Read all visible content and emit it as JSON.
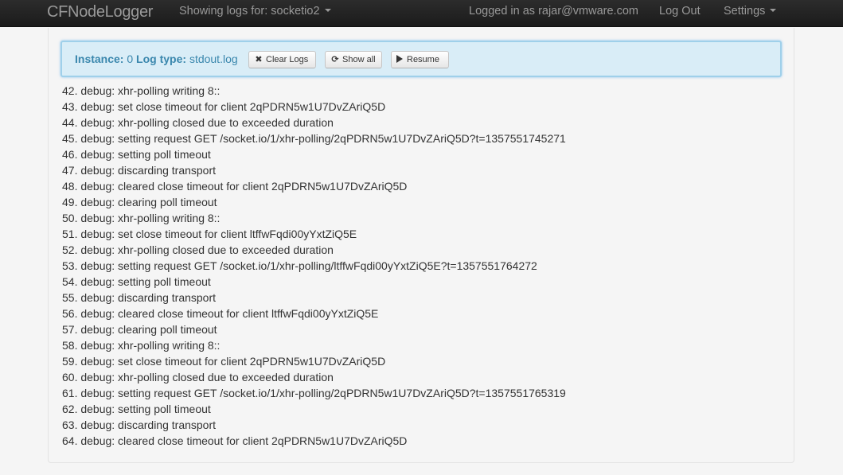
{
  "navbar": {
    "brand": "CFNodeLogger",
    "showing": "Showing logs for: socketio2",
    "logged_in": "Logged in as rajar@vmware.com",
    "logout": "Log Out",
    "settings": "Settings"
  },
  "toolbar": {
    "instance_label": "Instance:",
    "instance_value": "0",
    "logtype_label": "Log type:",
    "logtype_value": "stdout.log",
    "clear_label": "Clear Logs",
    "showall_label": "Show all",
    "resume_label": "Resume"
  },
  "logs": [
    "42. debug: xhr-polling writing 8::",
    "43. debug: set close timeout for client 2qPDRN5w1U7DvZAriQ5D",
    "44. debug: xhr-polling closed due to exceeded duration",
    "45. debug: setting request GET /socket.io/1/xhr-polling/2qPDRN5w1U7DvZAriQ5D?t=1357551745271",
    "46. debug: setting poll timeout",
    "47. debug: discarding transport",
    "48. debug: cleared close timeout for client 2qPDRN5w1U7DvZAriQ5D",
    "49. debug: clearing poll timeout",
    "50. debug: xhr-polling writing 8::",
    "51. debug: set close timeout for client ltffwFqdi00yYxtZiQ5E",
    "52. debug: xhr-polling closed due to exceeded duration",
    "53. debug: setting request GET /socket.io/1/xhr-polling/ltffwFqdi00yYxtZiQ5E?t=1357551764272",
    "54. debug: setting poll timeout",
    "55. debug: discarding transport",
    "56. debug: cleared close timeout for client ltffwFqdi00yYxtZiQ5E",
    "57. debug: clearing poll timeout",
    "58. debug: xhr-polling writing 8::",
    "59. debug: set close timeout for client 2qPDRN5w1U7DvZAriQ5D",
    "60. debug: xhr-polling closed due to exceeded duration",
    "61. debug: setting request GET /socket.io/1/xhr-polling/2qPDRN5w1U7DvZAriQ5D?t=1357551765319",
    "62. debug: setting poll timeout",
    "63. debug: discarding transport",
    "64. debug: cleared close timeout for client 2qPDRN5w1U7DvZAriQ5D"
  ]
}
